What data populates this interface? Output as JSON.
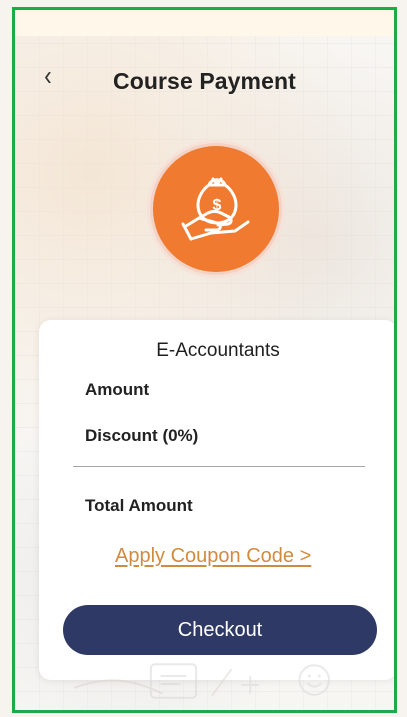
{
  "header": {
    "back_icon": "chevron-left-icon",
    "title": "Course Payment"
  },
  "hero": {
    "icon": "money-bag-hand-icon",
    "accent": "#f07a2f"
  },
  "payment": {
    "course_name": "E-Accountants",
    "amount_label": "Amount",
    "discount_label": "Discount (0%)",
    "total_label": "Total Amount",
    "coupon_link": "Apply Coupon Code >",
    "checkout_button": "Checkout"
  },
  "colors": {
    "frame": "#1eaa4a",
    "button": "#2f3966",
    "coupon": "#d18b40"
  }
}
